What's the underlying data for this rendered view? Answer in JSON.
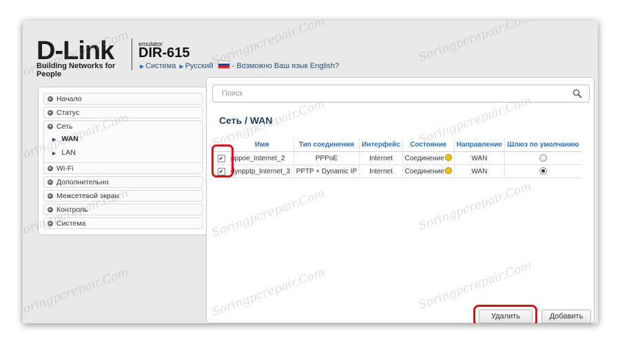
{
  "brand": {
    "logo": "D-Link",
    "tagline": "Building Networks for People",
    "emulator_label": "emulator",
    "model": "DIR-615"
  },
  "header_links": {
    "system": "Система",
    "language": "Русский",
    "language_prompt": "- Возможно Ваш язык English?"
  },
  "sidebar": {
    "items": [
      {
        "label": "Начало"
      },
      {
        "label": "Статус"
      },
      {
        "label": "Сеть"
      },
      {
        "label": "WAN"
      },
      {
        "label": "LAN"
      },
      {
        "label": "Wi-Fi"
      },
      {
        "label": "Дополнительно"
      },
      {
        "label": "Межсетевой экран"
      },
      {
        "label": "Контроль"
      },
      {
        "label": "Система"
      }
    ]
  },
  "search": {
    "placeholder": "Поиск"
  },
  "page_title": "Сеть /  WAN",
  "table": {
    "headers": [
      "Имя",
      "Тип соединения",
      "Интерфейс",
      "Состояние",
      "Направление",
      "Шлюз по умолчанию"
    ],
    "rows": [
      {
        "checked": true,
        "name": "pppoe_Internet_2",
        "type": "PPPoE",
        "interface": "Internet",
        "state": "Соединение",
        "direction": "WAN",
        "default_gateway": false
      },
      {
        "checked": true,
        "name": "dynpptp_Internet_3",
        "type": "PPTP + Dynamic IP",
        "interface": "Internet",
        "state": "Соединение",
        "direction": "WAN",
        "default_gateway": true
      }
    ]
  },
  "buttons": {
    "delete": "Удалить",
    "add": "Добавить"
  },
  "watermark": "Soringpcrepair.Com",
  "colors": {
    "accent_blue": "#2b6fb5",
    "title_blue": "#1f3d5e",
    "highlight_red": "#d3141b",
    "status_yellow": "#f5c400"
  }
}
